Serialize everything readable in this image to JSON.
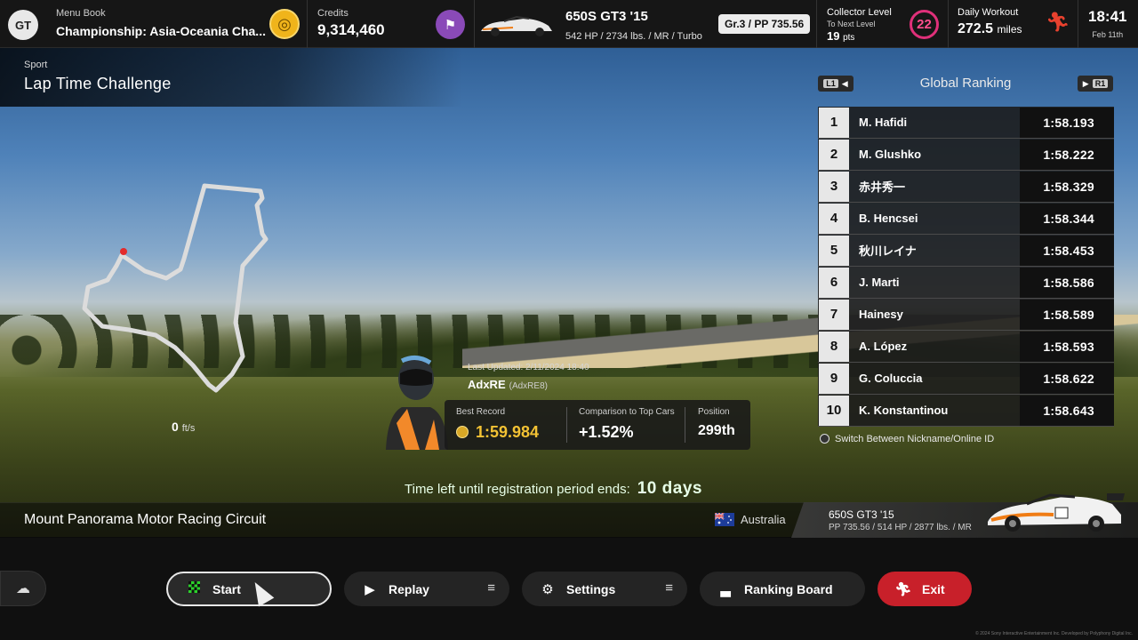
{
  "topbar": {
    "logo": "GT",
    "menu_book_label": "Menu Book",
    "menu_book_value": "Championship: Asia-Oceania Cha...",
    "credits_label": "Credits",
    "credits_value": "9,314,460",
    "car_name": "650S GT3 '15",
    "car_spec": "542 HP / 2734 lbs. / MR / Turbo",
    "car_badge": "Gr.3 / PP 735.56",
    "collector_label": "Collector Level",
    "collector_next": "To Next Level",
    "collector_pts": "19",
    "collector_pts_unit": "pts",
    "collector_level": "22",
    "workout_label": "Daily Workout",
    "workout_value": "272.5",
    "workout_unit": "miles",
    "time": "18:41",
    "date": "Feb 11th"
  },
  "header": {
    "category": "Sport",
    "title": "Lap Time Challenge"
  },
  "speed": {
    "value": "0",
    "unit": "ft/s"
  },
  "record": {
    "last_updated": "Last Updated: 2/11/2024 18:40",
    "player_name": "AdxRE",
    "player_id": "(AdxRE8)",
    "best_label": "Best Record",
    "best_value": "1:59.984",
    "compare_label": "Comparison to Top Cars",
    "compare_value": "+1.52%",
    "position_label": "Position",
    "position_value": "299th"
  },
  "ranking": {
    "l1": "L1",
    "r1": "R1",
    "title": "Global Ranking",
    "rows": [
      {
        "rank": "1",
        "name": "M. Hafidi",
        "time": "1:58.193"
      },
      {
        "rank": "2",
        "name": "M. Glushko",
        "time": "1:58.222"
      },
      {
        "rank": "3",
        "name": "赤井秀一",
        "time": "1:58.329"
      },
      {
        "rank": "4",
        "name": "B. Hencsei",
        "time": "1:58.344"
      },
      {
        "rank": "5",
        "name": "秋川レイナ",
        "time": "1:58.453"
      },
      {
        "rank": "6",
        "name": "J. Marti",
        "time": "1:58.586"
      },
      {
        "rank": "7",
        "name": "Hainesy",
        "time": "1:58.589"
      },
      {
        "rank": "8",
        "name": "A. López",
        "time": "1:58.593"
      },
      {
        "rank": "9",
        "name": "G. Coluccia",
        "time": "1:58.622"
      },
      {
        "rank": "10",
        "name": "K. Konstantinou",
        "time": "1:58.643"
      }
    ],
    "switch_hint": "Switch Between Nickname/Online ID"
  },
  "registration": {
    "text": "Time left until registration period ends:",
    "value": "10 days"
  },
  "track": {
    "name": "Mount Panorama Motor Racing Circuit",
    "country": "Australia"
  },
  "car_panel": {
    "name": "650S GT3 '15",
    "spec": "PP 735.56 / 514 HP / 2877 lbs. / MR"
  },
  "buttons": {
    "start": "Start",
    "replay": "Replay",
    "settings": "Settings",
    "ranking_board": "Ranking Board",
    "exit": "Exit"
  },
  "copyright": "© 2024 Sony Interactive Entertainment Inc. Developed by Polyphony Digital Inc.",
  "colors": {
    "accent_gold": "#f3c234",
    "exit_red": "#c8202a",
    "level_pink": "#e0307a"
  }
}
